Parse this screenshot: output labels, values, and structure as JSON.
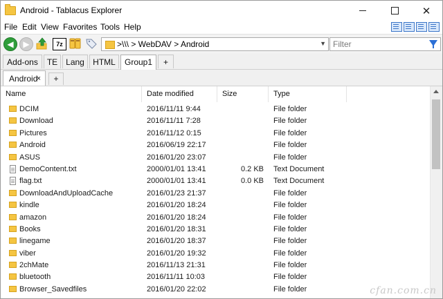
{
  "window": {
    "title": "Android - Tablacus Explorer"
  },
  "menu": [
    "File",
    "Edit",
    "View",
    "Favorites",
    "Tools",
    "Help"
  ],
  "toolbar": {
    "seven_z_label": "7z",
    "address_path": ">\\\\\\ > WebDAV > Android",
    "filter_placeholder": "Filter"
  },
  "group_tabs": [
    {
      "label": "Add-ons"
    },
    {
      "label": "TE"
    },
    {
      "label": "Lang"
    },
    {
      "label": "HTML"
    },
    {
      "label": "Group1",
      "active": true
    }
  ],
  "folder_tab": {
    "label": "Android",
    "close": "×",
    "add": "+"
  },
  "group_add": "+",
  "columns": {
    "name": "Name",
    "date": "Date modified",
    "size": "Size",
    "type": "Type"
  },
  "files": [
    {
      "name": "DCIM",
      "date": "2016/11/11 9:44",
      "size": "",
      "type": "File folder",
      "kind": "folder"
    },
    {
      "name": "Download",
      "date": "2016/11/11 7:28",
      "size": "",
      "type": "File folder",
      "kind": "folder"
    },
    {
      "name": "Pictures",
      "date": "2016/11/12 0:15",
      "size": "",
      "type": "File folder",
      "kind": "folder"
    },
    {
      "name": "Android",
      "date": "2016/06/19 22:17",
      "size": "",
      "type": "File folder",
      "kind": "folder"
    },
    {
      "name": "ASUS",
      "date": "2016/01/20 23:07",
      "size": "",
      "type": "File folder",
      "kind": "folder"
    },
    {
      "name": "DemoContent.txt",
      "date": "2000/01/01 13:41",
      "size": "0.2 KB",
      "type": "Text Document",
      "kind": "file"
    },
    {
      "name": "flag.txt",
      "date": "2000/01/01 13:41",
      "size": "0.0 KB",
      "type": "Text Document",
      "kind": "file"
    },
    {
      "name": "DownloadAndUploadCache",
      "date": "2016/01/23 21:37",
      "size": "",
      "type": "File folder",
      "kind": "folder"
    },
    {
      "name": "kindle",
      "date": "2016/01/20 18:24",
      "size": "",
      "type": "File folder",
      "kind": "folder"
    },
    {
      "name": "amazon",
      "date": "2016/01/20 18:24",
      "size": "",
      "type": "File folder",
      "kind": "folder"
    },
    {
      "name": "Books",
      "date": "2016/01/20 18:31",
      "size": "",
      "type": "File folder",
      "kind": "folder"
    },
    {
      "name": "linegame",
      "date": "2016/01/20 18:37",
      "size": "",
      "type": "File folder",
      "kind": "folder"
    },
    {
      "name": "viber",
      "date": "2016/01/20 19:32",
      "size": "",
      "type": "File folder",
      "kind": "folder"
    },
    {
      "name": "2chMate",
      "date": "2016/11/13 21:31",
      "size": "",
      "type": "File folder",
      "kind": "folder"
    },
    {
      "name": "bluetooth",
      "date": "2016/11/11 10:03",
      "size": "",
      "type": "File folder",
      "kind": "folder"
    },
    {
      "name": "Browser_Savedfiles",
      "date": "2016/01/20 22:02",
      "size": "",
      "type": "File folder",
      "kind": "folder"
    }
  ],
  "watermark": "cfan.com.cn"
}
